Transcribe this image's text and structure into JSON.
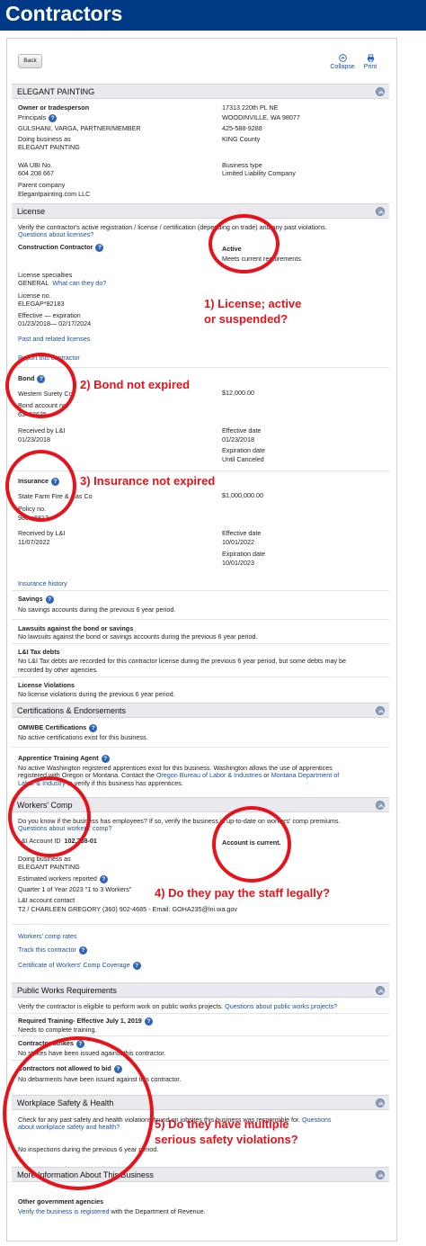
{
  "banner": {
    "title": "Contractors"
  },
  "toolbar": {
    "back": "Back",
    "collapse": "Collapse",
    "print": "Print"
  },
  "company": {
    "name": "ELEGANT PAINTING",
    "owner_heading": "Owner or tradesperson",
    "principals_label": "Principals",
    "principals_value": "GULSHANI, VARGA, PARTNER/MEMBER",
    "dba_label": "Doing business as",
    "dba_value": "ELEGANT PAINTING",
    "address1": "17313 220th PL NE",
    "address2": "WOODINVILLE, WA 98077",
    "phone": "425-588-9288",
    "county": "KING County",
    "ubi_label": "WA UBI No.",
    "ubi_value": "604 208 667",
    "parent_label": "Parent company",
    "parent_value": "Elegantpainting.com LLC",
    "btype_label": "Business type",
    "btype_value": "Limited Liability Company"
  },
  "license": {
    "section_title": "License",
    "intro": "Verify the contractor's active registration / license / certification (depending on trade) and any past violations.",
    "questions_link": "Questions about licenses?",
    "type": "Construction Contractor",
    "status": "Active",
    "status_note": "Meets current requirements.",
    "specialties_label": "License specialties",
    "specialties_value": "GENERAL",
    "what_link": "What can they do?",
    "no_label": "License no.",
    "no_value": "ELEGAP*82183",
    "effective_label": "Effective — expiration",
    "effective_value": "01/23/2018— 02/17/2024",
    "past_link": "Past and related licenses",
    "report_link": "Report this contractor"
  },
  "bond": {
    "heading": "Bond",
    "company": "Western Surety Co",
    "amount": "$12,000.00",
    "account_label": "Bond account no.",
    "account_value": "63433635",
    "received_label": "Received by L&I",
    "received_value": "01/23/2018",
    "effective_label": "Effective date",
    "effective_value": "01/23/2018",
    "expiration_label": "Expiration date",
    "expiration_value": "Until Canceled"
  },
  "insurance": {
    "heading": "Insurance",
    "company": "State Farm Fire & Cas Co",
    "amount": "$1,000,000.00",
    "policy_label": "Policy no.",
    "policy_value": "98em6812",
    "received_label": "Received by L&I",
    "received_value": "11/07/2022",
    "effective_label": "Effective date",
    "effective_value": "10/01/2022",
    "expiration_label": "Expiration date",
    "expiration_value": "10/01/2023",
    "history_link": "Insurance history"
  },
  "records": {
    "savings_h": "Savings",
    "savings_t": "No savings accounts during the previous 6 year period.",
    "lawsuits_h": "Lawsuits against the bond or savings",
    "lawsuits_t": "No lawsuits against the bond or savings accounts during the previous 6 year period.",
    "tax_h": "L&I Tax debts",
    "tax_t1": "No L&I Tax debts are recorded for this contractor license during the previous 6 year period, but some debts may be",
    "tax_t2": "recorded by other agencies.",
    "violations_h": "License Violations",
    "violations_t": "No license violations during the previous 6 year period."
  },
  "certs": {
    "section_title": "Certifications & Endorsements",
    "omwbe_h": "OMWBE Certifications",
    "omwbe_t": "No active certifications exist for this business.",
    "apprentice_h": "Apprentice Training Agent",
    "apprentice_t1": "No active Washington registered apprentices exist for this business. Washington allows the use of apprentices",
    "apprentice_t2a": "registered with Oregon or Montana. Contact the",
    "apprentice_link1": "Oregon Bureau of Labor & Industries",
    "apprentice_or": "or",
    "apprentice_link2": "Montana Department of",
    "apprentice_link3": "Labor & Industry",
    "apprentice_t3": "to verify if this business has apprentices."
  },
  "workers": {
    "section_title": "Workers' Comp",
    "intro": "Do you know if the business has employees? If so, verify the business is up-to-date on workers' comp premiums.",
    "questions_link": "Questions about workers' comp?",
    "account_label": "L&I Account ID",
    "account_value": "102,738-01",
    "status": "Account is current.",
    "dba_label": "Doing business as",
    "dba_value": "ELEGANT PAINTING",
    "estimated_label": "Estimated workers reported",
    "estimated_value": "Quarter 1 of Year 2023 \"1 to 3 Workers\"",
    "contact_label": "L&I account contact",
    "contact_value": "T2 / CHARLEEN GREGORY (360) 902-4685 - Email: GOHA235@lni.wa.gov",
    "rates_link": "Workers' comp rates",
    "track_link": "Track this contractor",
    "cert_link": "Certificate of Workers' Comp Coverage"
  },
  "public_works": {
    "section_title": "Public Works Requirements",
    "intro": "Verify the contractor is eligible to perform work on public works projects.",
    "questions_link": "Questions about public works projects?",
    "training_h": "Required Training- Effective July 1, 2019",
    "training_t": "Needs to complete training.",
    "strikes_h": "Contractor strikes",
    "strikes_t": "No strikes have been issued against this contractor.",
    "bid_h": "Contractors not allowed to bid",
    "bid_t": "No debarments have been issued against this contractor."
  },
  "safety": {
    "section_title": "Workplace Safety & Health",
    "intro": "Check for any past safety and health violations found on jobsites this business was responsible for.",
    "questions_link1": "Questions",
    "questions_link2": "about workplace safety and health?",
    "inspections": "No inspections during the previous 6 year period."
  },
  "more": {
    "section_title": "More Information About This Business",
    "agencies_h": "Other government agencies",
    "verify_link": "Verify the business is registered",
    "verify_t": "with the Department of Revenue."
  },
  "annotations": {
    "a1_line1": "1) License; active",
    "a1_line2": "or suspended?",
    "a2": "2) Bond not expired",
    "a3": "3) Insurance not expired",
    "a4": "4) Do they pay the staff legally?",
    "a5_line1": "5) Do they have multiple",
    "a5_line2": "serious safety violations?",
    "color": "#e8121a"
  },
  "icons": [
    "collapse-icon",
    "print-icon",
    "help-icon",
    "chevron-up-icon"
  ]
}
